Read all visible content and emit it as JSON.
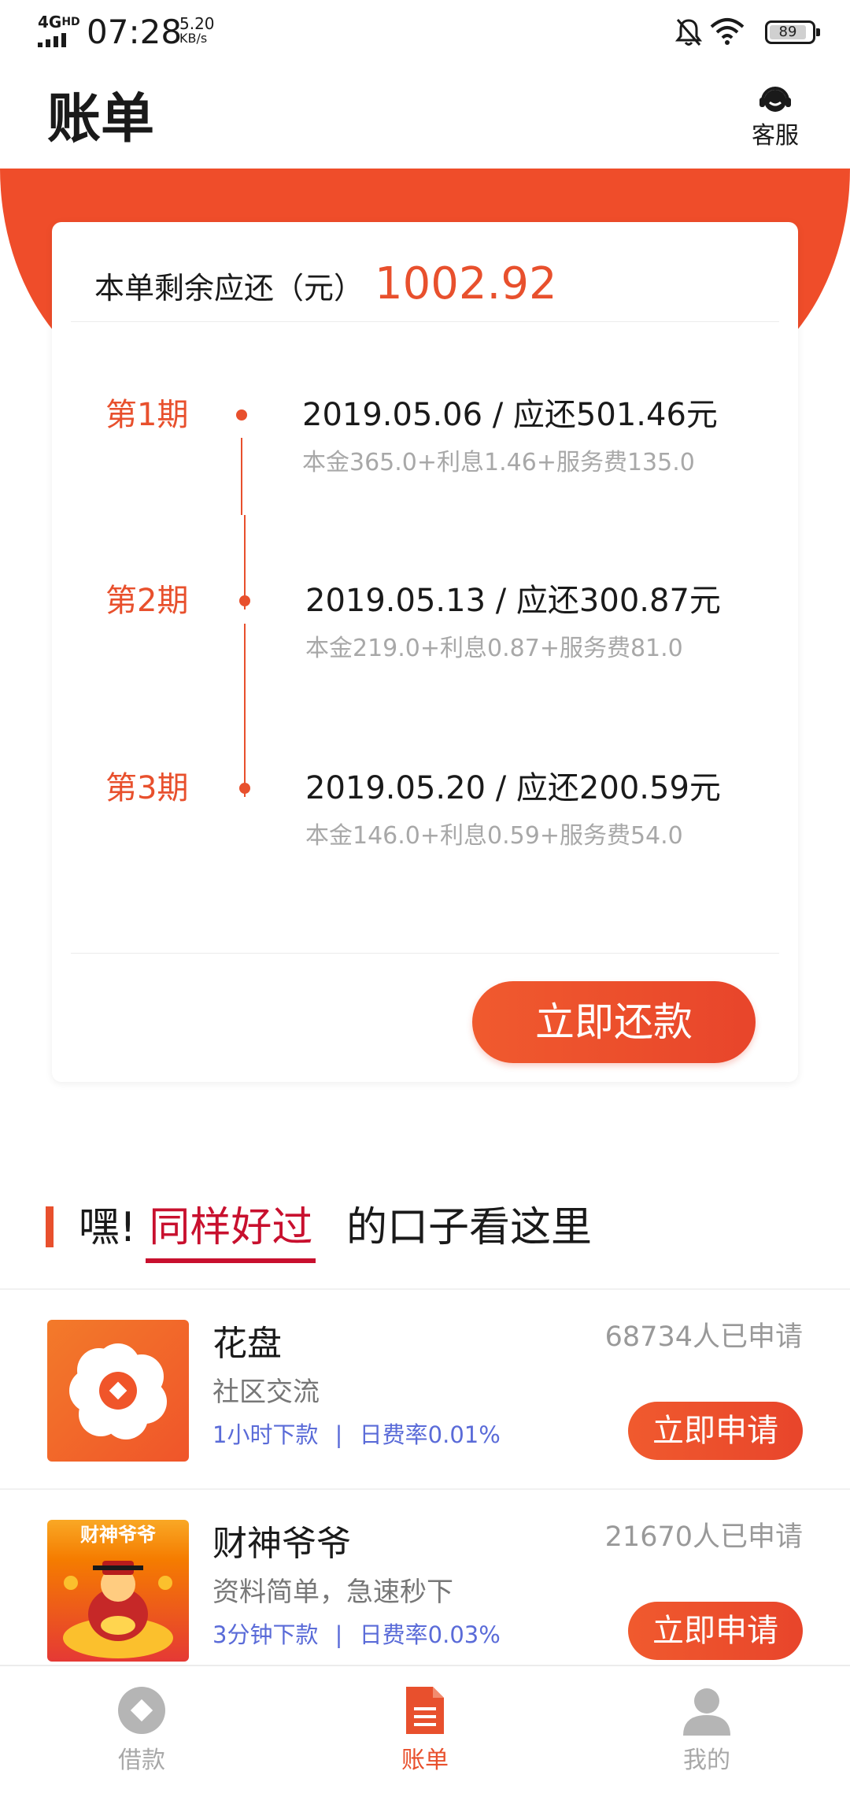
{
  "status_bar": {
    "network": "4G",
    "network_sub": "HD",
    "time": "07:28",
    "speed_value": "5.20",
    "speed_unit": "KB/s",
    "battery": "89",
    "icons": [
      "mute-bell-icon",
      "wifi-icon",
      "battery-icon"
    ]
  },
  "header": {
    "title": "账单",
    "customer_service_label": "客服"
  },
  "bill": {
    "remaining_label": "本单剩余应还（元）",
    "remaining_amount": "1002.92",
    "installments": [
      {
        "period": "第1期",
        "summary": "2019.05.06 / 应还501.46元",
        "detail": "本金365.0+利息1.46+服务费135.0"
      },
      {
        "period": "第2期",
        "summary": "2019.05.13 / 应还300.87元",
        "detail": "本金219.0+利息0.87+服务费81.0"
      },
      {
        "period": "第3期",
        "summary": "2019.05.20 / 应还200.59元",
        "detail": "本金146.0+利息0.59+服务费54.0"
      }
    ],
    "repay_button": "立即还款"
  },
  "promo": {
    "prefix": "嘿!",
    "highlight": "同样好过",
    "suffix": "的口子看这里"
  },
  "loans": [
    {
      "name": "花盘",
      "desc": "社区交流",
      "tag1": "1小时下款",
      "tag_sep": "|",
      "tag2": "日费率0.01%",
      "count": "68734人已申请",
      "apply": "立即申请"
    },
    {
      "name": "财神爷爷",
      "desc": "资料简单，急速秒下",
      "tag1": "3分钟下款",
      "tag_sep": "|",
      "tag2": "日费率0.03%",
      "count": "21670人已申请",
      "apply": "立即申请",
      "logo_text": "财神爷爷"
    }
  ],
  "bottom_nav": [
    {
      "label": "借款",
      "icon": "loan-diamond-icon",
      "active": false
    },
    {
      "label": "账单",
      "icon": "bill-document-icon",
      "active": true
    },
    {
      "label": "我的",
      "icon": "user-profile-icon",
      "active": false
    }
  ],
  "colors": {
    "accent": "#e8502d",
    "header_red": "#ef4d2a",
    "highlight_red": "#c8102e",
    "tag_blue": "#5a6bd8"
  }
}
